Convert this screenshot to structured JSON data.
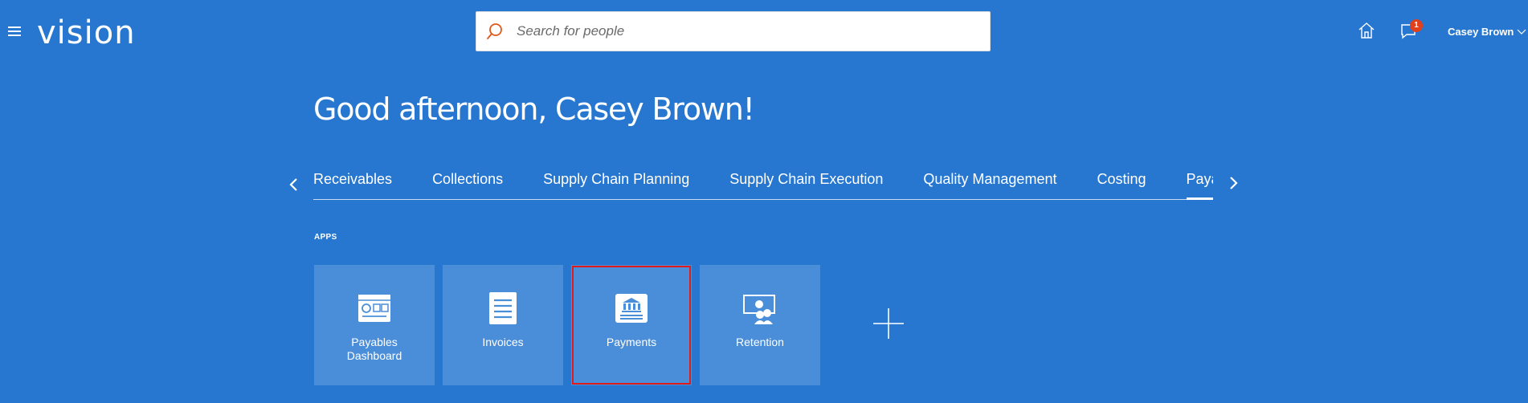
{
  "app": {
    "logo": "vision"
  },
  "search": {
    "placeholder": "Search for people"
  },
  "header": {
    "notification_count": "1",
    "user_name": "Casey Brown"
  },
  "greeting": "Good afternoon, Casey Brown!",
  "tabs": [
    {
      "label": "Receivables"
    },
    {
      "label": "Collections"
    },
    {
      "label": "Supply Chain Planning"
    },
    {
      "label": "Supply Chain Execution"
    },
    {
      "label": "Quality Management"
    },
    {
      "label": "Costing"
    },
    {
      "label": "Payables",
      "active": true
    }
  ],
  "apps_section": {
    "label": "APPS"
  },
  "tiles": [
    {
      "label": "Payables Dashboard",
      "icon": "dashboard-icon"
    },
    {
      "label": "Invoices",
      "icon": "document-icon"
    },
    {
      "label": "Payments",
      "icon": "bank-icon",
      "selected": true
    },
    {
      "label": "Retention",
      "icon": "retention-icon"
    }
  ],
  "colors": {
    "background": "#2777d0",
    "tile": "#4a8ed9",
    "badge": "#e0401c",
    "selection": "#e01b1b",
    "search_icon": "#e0581c"
  }
}
